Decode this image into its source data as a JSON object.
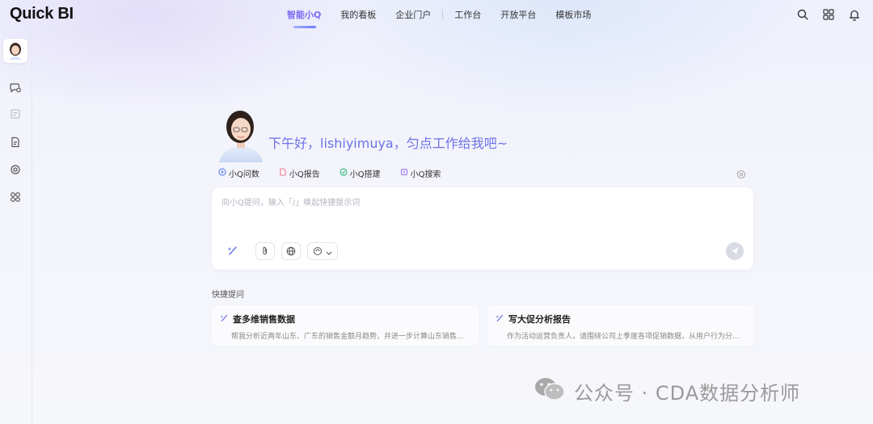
{
  "app": {
    "logo": "Quick BI"
  },
  "nav": {
    "items": [
      {
        "label": "智能小Q",
        "active": true
      },
      {
        "label": "我的看板"
      },
      {
        "label": "企业门户"
      },
      {
        "label": "工作台"
      },
      {
        "label": "开放平台"
      },
      {
        "label": "模板市场"
      }
    ]
  },
  "header_icons": [
    "search-icon",
    "apps-grid-icon",
    "bell-icon"
  ],
  "sidebar": {
    "items": [
      "avatar",
      "chat-history-icon",
      "document-icon",
      "report-icon",
      "settings-gear-icon",
      "apps-icon"
    ]
  },
  "hero": {
    "greeting": "下午好，lishiyimuya，匀点工作给我吧~"
  },
  "modes": [
    {
      "label": "小Q问数",
      "icon": "query-icon"
    },
    {
      "label": "小Q报告",
      "icon": "report-icon"
    },
    {
      "label": "小Q搭建",
      "icon": "build-icon"
    },
    {
      "label": "小Q搜索",
      "icon": "search-doc-icon"
    }
  ],
  "input": {
    "placeholder": "向小Q提问，输入「/」唤起快捷提示词"
  },
  "quick": {
    "title": "快捷提问",
    "cards": [
      {
        "title": "查多维销售数据",
        "desc": "帮我分析近两年山东、广东的销售金额月趋势，并进一步计算山东销售..."
      },
      {
        "title": "写大促分析报告",
        "desc": "作为活动运营负责人，请围绕公司上季度各项促销数据，从用户行为分..."
      }
    ]
  },
  "watermark": {
    "text": "公众号 · CDA数据分析师"
  },
  "colors": {
    "accent": "#6d71e8",
    "nav_active": "#7b6cf2"
  }
}
